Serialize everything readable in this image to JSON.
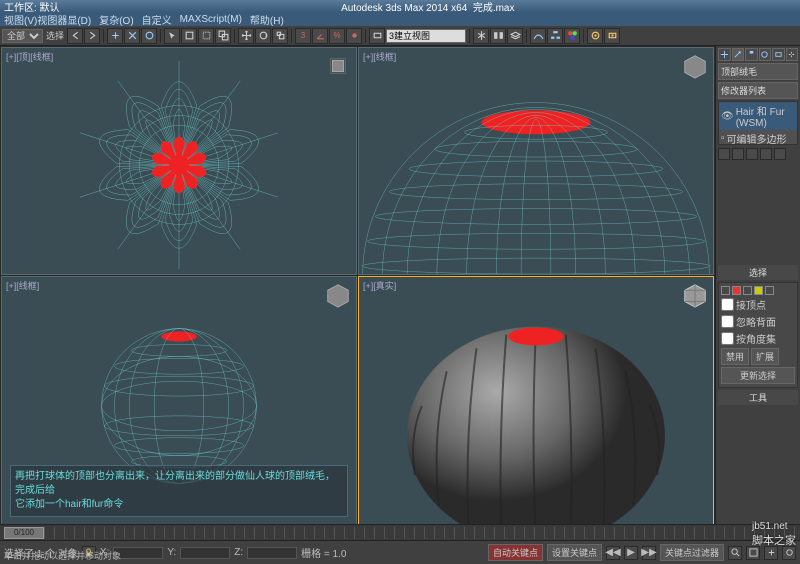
{
  "titlebar": {
    "app_title": "Autodesk 3ds Max 2014 x64",
    "file": "完成.max",
    "window_label": "工作区: 默认"
  },
  "menubar": {
    "items": [
      "视图(V)视图器显(D)",
      "复杂(O)",
      "自定义",
      "MAXScript(M)",
      "帮助(H)"
    ]
  },
  "toolbar": {
    "selector_all": "全部",
    "mode_label": "选择",
    "coord_input": "3建立视图"
  },
  "viewports": {
    "top": {
      "label": "[+][顶][线框]"
    },
    "front": {
      "label": "[+][线框]"
    },
    "left": {
      "label": "[+][线框]"
    },
    "persp": {
      "label": "[+][真实]"
    }
  },
  "overlay": {
    "line1": "再把打球体的顶部也分离出来，让分离出来的部分做仙人球的顶部绒毛，完成后给",
    "line2": "它添加一个hair和fur命令"
  },
  "cmdpanel": {
    "header": "顶部绒毛",
    "modlist_label": "修改器列表",
    "stack": [
      {
        "icon": "eye",
        "label": "Hair 和 Fur (WSM)",
        "selected": true
      },
      {
        "icon": "box",
        "label": "可编辑多边形",
        "selected": false
      }
    ],
    "rollout_select_title": "选择",
    "chk_by_vertex": "接顶点",
    "chk_ignore_back": "忽略背面",
    "chk_by_angle": "按角度集",
    "btn_shrink": "禁用",
    "btn_grow": "扩展",
    "btn_update": "更新选择",
    "rollout_tools_title": "工具"
  },
  "timeline": {
    "pos": "0/100"
  },
  "statusbar": {
    "selection": "选择了 1 个 对象",
    "prompt": "单击并拖动以选择并移动对象",
    "x": "X:",
    "y": "Y:",
    "z": "Z:",
    "grid": "栅格 = 1.0",
    "auto_key": "自动关键点",
    "set_key": "设置关键点",
    "key_filter": "关键点过滤器"
  },
  "watermark": {
    "main": "jb51.net",
    "sub": "脚本之家"
  }
}
